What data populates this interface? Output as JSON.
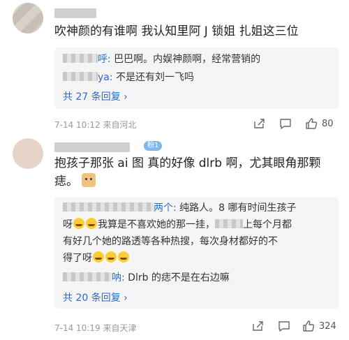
{
  "comment1": {
    "text": "吹神颜的有谁啊 我认知里阿 J 锁姐 扎姐这三位",
    "replies": [
      {
        "suffix": "呼:",
        "text": " 巴巴啊。内娱神颜啊，经常营销的"
      },
      {
        "suffix": "ya:",
        "text": " 不是还有刘一飞吗"
      }
    ],
    "more": "共 27 条回复",
    "meta": "7-14 10:12  来自河北",
    "likes": "80"
  },
  "comment2": {
    "badge": "粉1",
    "text_line1": "抱孩子那张 ai 图 真的好像 dlrb 啊，尤其眼角那颗",
    "text_line2": "痣。",
    "replies": [
      {
        "suffix": "两个:",
        "text": " 纯路人。8 哪有时间生孩子"
      },
      {
        "text": "呀"
      },
      {
        "text": "我算是不喜欢她的那一挂，"
      },
      {
        "text": "上每个月都"
      },
      {
        "text": "有好几个她的路透等各种热搜，每次身材都好的不"
      },
      {
        "text": "得了呀"
      },
      {
        "suffix": "呐:",
        "text": " Dlrb 的痣不是在右边嘛"
      }
    ],
    "more": "共 20 条回复",
    "meta": "7-14 10:19  来自天津",
    "likes": "324"
  }
}
